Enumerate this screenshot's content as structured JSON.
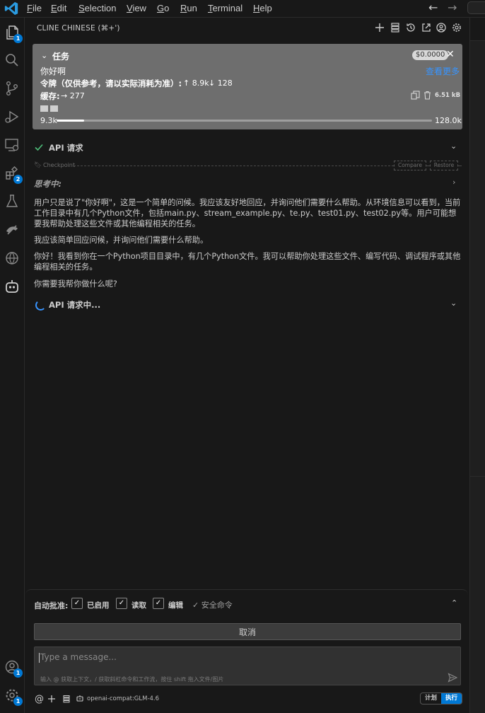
{
  "menubar": {
    "items": [
      "File",
      "Edit",
      "Selection",
      "View",
      "Go",
      "Run",
      "Terminal",
      "Help"
    ],
    "back_icon": "arrow-left-icon",
    "forward_icon": "arrow-right-icon"
  },
  "activity": {
    "explorer_badge": "1",
    "extensions_badge": "2",
    "accounts_badge": "1",
    "settings_badge": "1"
  },
  "panel": {
    "title": "CLINE CHINESE (⌘+')"
  },
  "task": {
    "title": "任务",
    "cost": "$0.0000",
    "message": "你好啊",
    "view_more": "查看更多",
    "tokens_label": "令牌（仅供参考，请以实际消耗为准）:",
    "tokens_in": "↑ 8.9k",
    "tokens_out": "↓ 128",
    "cache_label": "缓存:",
    "cache_value": "→ 277",
    "size": "6.51 kB",
    "context_used": "9.3k",
    "context_max": "128.0k",
    "context_fraction": 0.073
  },
  "api_request": {
    "label": "API 请求",
    "status": "done"
  },
  "checkpoint": {
    "label": "Checkpoint",
    "compare": "Compare",
    "restore": "Restore"
  },
  "thinking": {
    "label": "思考中:"
  },
  "messages": [
    "用户只是说了\"你好啊\"，这是一个简单的问候。我应该友好地回应，并询问他们需要什么帮助。从环境信息可以看到，当前工作目录中有几个Python文件，包括main.py、stream_example.py、te.py、test01.py、test02.py等。用户可能想要我帮助处理这些文件或其他编程相关的任务。",
    "我应该简单回应问候，并询问他们需要什么帮助。",
    "你好！我看到你在一个Python项目目录中，有几个Python文件。我可以帮助你处理这些文件、编写代码、调试程序或其他编程相关的任务。",
    "你需要我帮你做什么呢?"
  ],
  "api_pending": {
    "label": "API 请求中..."
  },
  "auto_approve": {
    "label": "自动批准:",
    "options": [
      {
        "label": "已启用",
        "checked": true
      },
      {
        "label": "读取",
        "checked": true
      },
      {
        "label": "编辑",
        "checked": true
      }
    ],
    "safe_command": "✓ 安全命令"
  },
  "cancel_label": "取消",
  "input": {
    "placeholder": "Type a message...",
    "hint": "输入 @ 获取上下文，/ 获取斜杠命令和工作流，按住 shift 拖入文件/图片"
  },
  "toolbar": {
    "model": "openai-compat:GLM-4.6",
    "plan_label": "计划",
    "act_label": "执行"
  },
  "colors": {
    "accent": "#0078d4",
    "link": "#3794ff",
    "success": "#4ec07a",
    "background": "#181818"
  }
}
